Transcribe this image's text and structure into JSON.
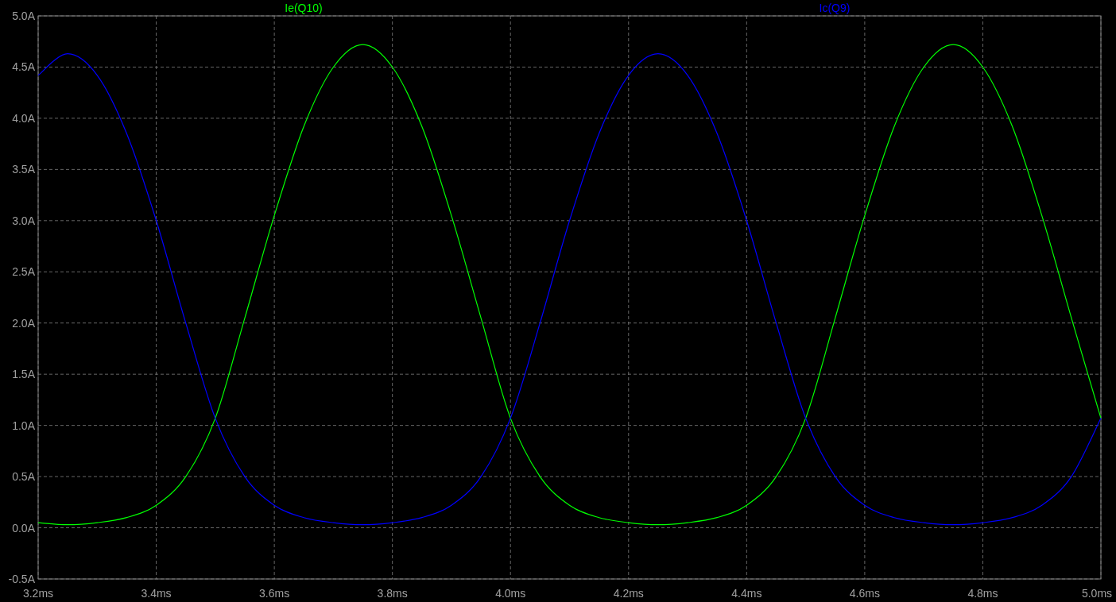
{
  "chart_data": {
    "type": "line",
    "x": [
      3.2,
      3.25,
      3.3,
      3.35,
      3.4,
      3.45,
      3.5,
      3.55,
      3.6,
      3.65,
      3.7,
      3.75,
      3.8,
      3.85,
      3.9,
      3.95,
      4.0,
      4.05,
      4.1,
      4.15,
      4.2,
      4.25,
      4.3,
      4.35,
      4.4,
      4.45,
      4.5,
      4.55,
      4.6,
      4.65,
      4.7,
      4.75,
      4.8,
      4.85,
      4.9,
      4.95,
      5.0
    ],
    "series": [
      {
        "name": "Ie(Q10)",
        "color": "#00ff00",
        "values": [
          0.05,
          0.03,
          0.05,
          0.1,
          0.22,
          0.5,
          1.07,
          2.05,
          3.05,
          3.92,
          4.5,
          4.72,
          4.5,
          3.92,
          3.05,
          2.05,
          1.07,
          0.5,
          0.22,
          0.1,
          0.05,
          0.03,
          0.05,
          0.1,
          0.22,
          0.5,
          1.07,
          2.05,
          3.05,
          3.92,
          4.5,
          4.72,
          4.5,
          3.92,
          3.05,
          2.05,
          1.07
        ]
      },
      {
        "name": "Ic(Q9)",
        "color": "#0000ff",
        "values": [
          4.42,
          4.63,
          4.42,
          3.85,
          3.0,
          2.0,
          1.07,
          0.5,
          0.22,
          0.1,
          0.05,
          0.03,
          0.05,
          0.1,
          0.22,
          0.5,
          1.07,
          2.0,
          3.0,
          3.85,
          4.42,
          4.63,
          4.42,
          3.85,
          3.0,
          2.0,
          1.07,
          0.5,
          0.22,
          0.1,
          0.05,
          0.03,
          0.05,
          0.1,
          0.22,
          0.5,
          1.07
        ]
      }
    ],
    "grid": true,
    "xlim": [
      3.2,
      5.0
    ],
    "ylim": [
      -0.5,
      5.0
    ],
    "xticks": [
      {
        "value": 3.2,
        "label": "3.2ms"
      },
      {
        "value": 3.4,
        "label": "3.4ms"
      },
      {
        "value": 3.6,
        "label": "3.6ms"
      },
      {
        "value": 3.8,
        "label": "3.8ms"
      },
      {
        "value": 4.0,
        "label": "4.0ms"
      },
      {
        "value": 4.2,
        "label": "4.2ms"
      },
      {
        "value": 4.4,
        "label": "4.4ms"
      },
      {
        "value": 4.6,
        "label": "4.6ms"
      },
      {
        "value": 4.8,
        "label": "4.8ms"
      },
      {
        "value": 5.0,
        "label": "5.0ms"
      }
    ],
    "yticks": [
      {
        "value": 5.0,
        "label": "5.0A"
      },
      {
        "value": 4.5,
        "label": "4.5A"
      },
      {
        "value": 4.0,
        "label": "4.0A"
      },
      {
        "value": 3.5,
        "label": "3.5A"
      },
      {
        "value": 3.0,
        "label": "3.0A"
      },
      {
        "value": 2.5,
        "label": "2.5A"
      },
      {
        "value": 2.0,
        "label": "2.0A"
      },
      {
        "value": 1.5,
        "label": "1.5A"
      },
      {
        "value": 1.0,
        "label": "1.0A"
      },
      {
        "value": 0.5,
        "label": "0.5A"
      },
      {
        "value": 0.0,
        "label": "0.0A"
      },
      {
        "value": -0.5,
        "label": "-0.5A"
      }
    ]
  }
}
